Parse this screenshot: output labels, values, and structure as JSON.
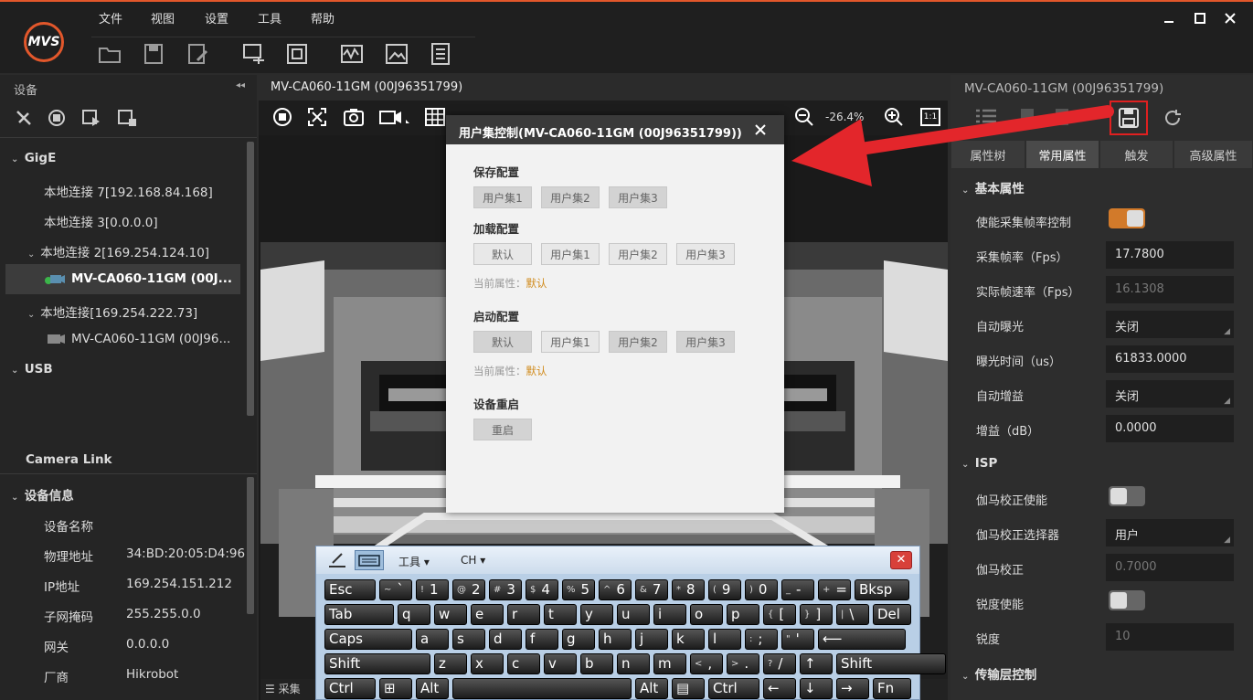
{
  "app": {
    "logo_text": "MVS",
    "accent": "#e2572b"
  },
  "menu": [
    "文件",
    "视图",
    "设置",
    "工具",
    "帮助"
  ],
  "left": {
    "header": "设备",
    "gige_label": "GigE",
    "tree": [
      {
        "label": "本地连接 7[192.168.84.168]",
        "level": 1
      },
      {
        "label": "本地连接 3[0.0.0.0]",
        "level": 1
      },
      {
        "label": "本地连接 2[169.254.124.10]",
        "level": 1
      },
      {
        "label": "MV-CA060-11GM (00J...",
        "level": 2,
        "selected": true
      },
      {
        "label": "本地连接[169.254.222.73]",
        "level": 1
      },
      {
        "label": "MV-CA060-11GM (00J96...",
        "level": 2
      }
    ],
    "usb_label": "USB",
    "cameralink_label": "Camera Link",
    "info_header": "设备信息",
    "info": [
      {
        "label": "设备名称",
        "value": ""
      },
      {
        "label": "物理地址",
        "value": "34:BD:20:05:D4:96"
      },
      {
        "label": "IP地址",
        "value": "169.254.151.212"
      },
      {
        "label": "子网掩码",
        "value": "255.255.0.0"
      },
      {
        "label": "网关",
        "value": "0.0.0.0"
      },
      {
        "label": "厂商",
        "value": "Hikrobot"
      }
    ]
  },
  "center": {
    "tab_title": "MV-CA060-11GM (00J96351799)",
    "zoom": "-26.4%",
    "ratio_icon_text": "1:1",
    "status_text": "采集"
  },
  "dialog": {
    "title": "用户集控制(MV-CA060-11GM (00J96351799))",
    "save_title": "保存配置",
    "save_buttons": [
      "用户集1",
      "用户集2",
      "用户集3"
    ],
    "load_title": "加载配置",
    "load_buttons": [
      "默认",
      "用户集1",
      "用户集2",
      "用户集3"
    ],
    "current_label": "当前属性：",
    "load_current": "默认",
    "startup_title": "启动配置",
    "startup_buttons": [
      "默认",
      "用户集1",
      "用户集2",
      "用户集3"
    ],
    "startup_current": "默认",
    "reboot_title": "设备重启",
    "reboot_button": "重启"
  },
  "right": {
    "title": "MV-CA060-11GM (00J96351799)",
    "tabs": [
      "属性树",
      "常用属性",
      "触发",
      "高级属性"
    ],
    "group_basic": "基本属性",
    "group_isp": "ISP",
    "group_transport": "传输层控制",
    "props": [
      {
        "label": "使能采集帧率控制",
        "value": "on"
      },
      {
        "label": "采集帧率（Fps）",
        "value": "17.7800"
      },
      {
        "label": "实际帧速率（Fps）",
        "value": "16.1308"
      },
      {
        "label": "自动曝光",
        "value": "关闭"
      },
      {
        "label": "曝光时间（us）",
        "value": "61833.0000"
      },
      {
        "label": "自动增益",
        "value": "关闭"
      },
      {
        "label": "增益（dB）",
        "value": "0.0000"
      }
    ],
    "isp_props": [
      {
        "label": "伽马校正使能",
        "value": "off"
      },
      {
        "label": "伽马校正选择器",
        "value": "用户"
      },
      {
        "label": "伽马校正",
        "value": "0.7000"
      },
      {
        "label": "锐度使能",
        "value": "off"
      },
      {
        "label": "锐度",
        "value": "10"
      }
    ]
  },
  "keyboard": {
    "tools_label": "工具",
    "lang_label": "CH",
    "rows": [
      [
        [
          "Esc",
          ""
        ],
        [
          "`",
          "~"
        ],
        [
          "1",
          "!"
        ],
        [
          "2",
          "@"
        ],
        [
          "3",
          "#"
        ],
        [
          "4",
          "$"
        ],
        [
          "5",
          "%"
        ],
        [
          "6",
          "^"
        ],
        [
          "7",
          "&"
        ],
        [
          "8",
          "*"
        ],
        [
          "9",
          "("
        ],
        [
          "0",
          ")"
        ],
        [
          "-",
          "_"
        ],
        [
          "=",
          "+"
        ],
        [
          "Bksp",
          ""
        ]
      ],
      [
        [
          "Tab",
          ""
        ],
        [
          "q",
          ""
        ],
        [
          "w",
          ""
        ],
        [
          "e",
          ""
        ],
        [
          "r",
          ""
        ],
        [
          "t",
          ""
        ],
        [
          "y",
          ""
        ],
        [
          "u",
          ""
        ],
        [
          "i",
          ""
        ],
        [
          "o",
          ""
        ],
        [
          "p",
          ""
        ],
        [
          "[",
          "{"
        ],
        [
          "]",
          "}"
        ],
        [
          "\\",
          "|"
        ],
        [
          "Del",
          ""
        ]
      ],
      [
        [
          "Caps",
          ""
        ],
        [
          "a",
          ""
        ],
        [
          "s",
          ""
        ],
        [
          "d",
          ""
        ],
        [
          "f",
          ""
        ],
        [
          "g",
          ""
        ],
        [
          "h",
          ""
        ],
        [
          "j",
          ""
        ],
        [
          "k",
          ""
        ],
        [
          "l",
          ""
        ],
        [
          ";",
          ":"
        ],
        [
          "'",
          "\""
        ],
        [
          "⟵",
          ""
        ]
      ],
      [
        [
          "Shift",
          ""
        ],
        [
          "z",
          ""
        ],
        [
          "x",
          ""
        ],
        [
          "c",
          ""
        ],
        [
          "v",
          ""
        ],
        [
          "b",
          ""
        ],
        [
          "n",
          ""
        ],
        [
          "m",
          ""
        ],
        [
          ",",
          "<"
        ],
        [
          ".",
          ">"
        ],
        [
          "/",
          "?"
        ],
        [
          "↑",
          ""
        ],
        [
          "Shift",
          ""
        ]
      ],
      [
        [
          "Ctrl",
          ""
        ],
        [
          "⊞",
          ""
        ],
        [
          "Alt",
          ""
        ],
        [
          " ",
          ""
        ],
        [
          "Alt",
          ""
        ],
        [
          "▤",
          ""
        ],
        [
          "Ctrl",
          ""
        ],
        [
          "←",
          ""
        ],
        [
          "↓",
          ""
        ],
        [
          "→",
          ""
        ],
        [
          "Fn",
          ""
        ]
      ]
    ]
  }
}
